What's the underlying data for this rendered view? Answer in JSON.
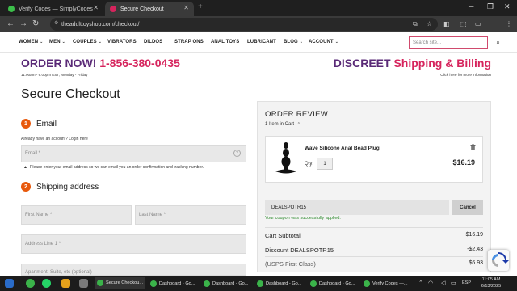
{
  "browser": {
    "tabs": [
      {
        "label": "Verify Codes — SimplyCodes",
        "icon": "simplycodes-icon"
      },
      {
        "label": "Secure Checkout",
        "icon": "site-favicon"
      }
    ],
    "new_tab": "+",
    "url": "theadulttoyshop.com/checkout/",
    "profile_initial": "T"
  },
  "site_nav": {
    "items": [
      "WOMEN",
      "MEN",
      "COUPLES",
      "VIBRATORS",
      "DILDOS",
      "STRAP ONS",
      "ANAL TOYS",
      "LUBRICANT",
      "BLOG",
      "ACCOUNT"
    ],
    "dropdown_caret": "⌄",
    "search_placeholder": "Search site..."
  },
  "banner": {
    "order_now": "ORDER NOW!",
    "phone": "1-856-380-0435",
    "hours": "11:00am - 6:00pm EST, Monday - Friday",
    "discreet": "DISCREET",
    "shipping_billing": "Shipping & Billing",
    "click_here": "Click here for more information"
  },
  "checkout": {
    "title": "Secure Checkout",
    "email_section": {
      "number": "1",
      "title": "Email"
    },
    "account_note": "Already have an account? Login here",
    "email_placeholder": "Email *",
    "email_help": "?",
    "email_note": "Please enter your email address so we can email you an order confirmation and tracking number.",
    "shipping_section": {
      "number": "2",
      "title": "Shipping address"
    },
    "first_name_placeholder": "First Name *",
    "last_name_placeholder": "Last Name *",
    "address1_placeholder": "Address Line 1 *",
    "address2_placeholder": "Apartment, Suite, etc (optional)"
  },
  "order_review": {
    "title": "ORDER REVIEW",
    "items_in_cart": "1 Item in Cart",
    "product": {
      "name": "Wave Silicone Anal Bead Plug",
      "qty_label": "Qty:",
      "qty": "1",
      "price": "$16.19"
    },
    "coupon_code": "DEALSPOTR15",
    "cancel_label": "Cancel",
    "coupon_success": "Your coupon was successfully applied.",
    "summary": [
      {
        "label": "Cart Subtotal",
        "value": "$16.19"
      },
      {
        "label": "Discount DEALSPOTR15",
        "value": "-$2.43"
      },
      {
        "label": "(USPS First Class)",
        "value": "$6.93"
      }
    ]
  },
  "taskbar": {
    "items": [
      {
        "label": "Secure Checkou...",
        "active": true
      },
      {
        "label": "Dashboard - Go...",
        "active": false
      },
      {
        "label": "Dashboard - Go...",
        "active": false
      },
      {
        "label": "Dashboard - Go...",
        "active": false
      },
      {
        "label": "Dashboard - Go...",
        "active": false
      },
      {
        "label": "Verify Codes —...",
        "active": false
      }
    ],
    "lang": "ESP",
    "time": "11:05 AM",
    "date": "6/13/2025"
  },
  "colors": {
    "brand_purple": "#5a2a77",
    "brand_pink": "#d6245d",
    "step_orange": "#e8590c",
    "success_green": "#2d8a2d"
  }
}
